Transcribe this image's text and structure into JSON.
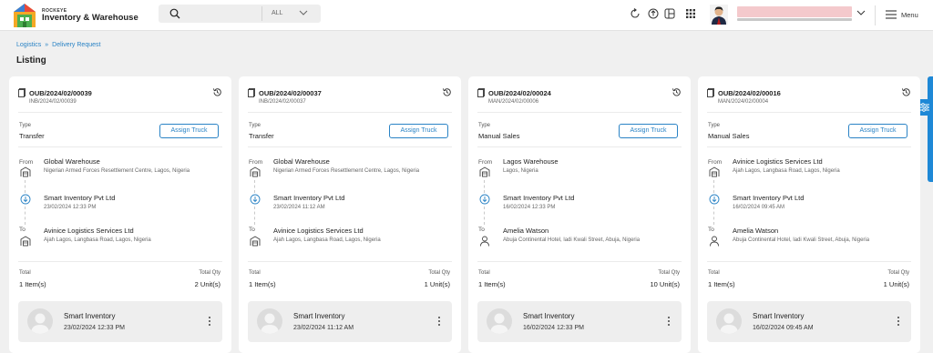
{
  "app": {
    "brand_small": "ROCKEYE",
    "brand_name": "Inventory & Warehouse",
    "search_placeholder": "",
    "search_scope": "ALL",
    "menu_label": "Menu",
    "accent": "#2a83c5"
  },
  "breadcrumb": {
    "items": [
      "Logistics",
      "Delivery Request"
    ]
  },
  "page_title": "Listing",
  "labels": {
    "type": "Type",
    "assign_truck": "Assign Truck",
    "from": "From",
    "to": "To",
    "total": "Total",
    "total_qty": "Total Qty"
  },
  "cards": [
    {
      "ref": "OUB/2024/02/00039",
      "subref": "INB/2024/02/00039",
      "type": "Transfer",
      "from_name": "Global Warehouse",
      "from_addr": "Nigerian Armed Forces Resettlement Centre, Lagos, Nigeria",
      "via_name": "Smart Inventory Pvt Ltd",
      "via_date": "23/02/2024 12:33 PM",
      "to_name": "Avinice Logistics Services Ltd",
      "to_addr": "Ajah Lagos, Langbasa Road, Lagos, Nigeria",
      "to_icon": "warehouse-icon",
      "total": "1 Item(s)",
      "total_qty": "2 Unit(s)",
      "footer_name": "Smart Inventory",
      "footer_date": "23/02/2024 12:33 PM"
    },
    {
      "ref": "OUB/2024/02/00037",
      "subref": "INB/2024/02/00037",
      "type": "Transfer",
      "from_name": "Global Warehouse",
      "from_addr": "Nigerian Armed Forces Resettlement Centre, Lagos, Nigeria",
      "via_name": "Smart Inventory Pvt Ltd",
      "via_date": "23/02/2024 11:12 AM",
      "to_name": "Avinice Logistics Services Ltd",
      "to_addr": "Ajah Lagos, Langbasa Road, Lagos, Nigeria",
      "to_icon": "warehouse-icon",
      "total": "1 Item(s)",
      "total_qty": "1 Unit(s)",
      "footer_name": "Smart Inventory",
      "footer_date": "23/02/2024 11:12 AM"
    },
    {
      "ref": "OUB/2024/02/00024",
      "subref": "MAN/2024/02/00006",
      "type": "Manual Sales",
      "from_name": "Lagos Warehouse",
      "from_addr": "Lagos, Nigeria",
      "via_name": "Smart Inventory Pvt Ltd",
      "via_date": "16/02/2024 12:33 PM",
      "to_name": "Amelia Watson",
      "to_addr": "Abuja Continental Hotel, ladi Kwali Street, Abuja, Nigeria",
      "to_icon": "person-icon",
      "total": "1 Item(s)",
      "total_qty": "10 Unit(s)",
      "footer_name": "Smart Inventory",
      "footer_date": "16/02/2024 12:33 PM"
    },
    {
      "ref": "OUB/2024/02/00016",
      "subref": "MAN/2024/02/00004",
      "type": "Manual Sales",
      "from_name": "Avinice Logistics Services Ltd",
      "from_addr": "Ajah Lagos, Langbasa Road, Lagos, Nigeria",
      "via_name": "Smart Inventory Pvt Ltd",
      "via_date": "16/02/2024 09:45 AM",
      "to_name": "Amelia Watson",
      "to_addr": "Abuja Continental Hotel, ladi Kwali Street, Abuja, Nigeria",
      "to_icon": "person-icon",
      "total": "1 Item(s)",
      "total_qty": "1 Unit(s)",
      "footer_name": "Smart Inventory",
      "footer_date": "16/02/2024 09:45 AM"
    }
  ]
}
